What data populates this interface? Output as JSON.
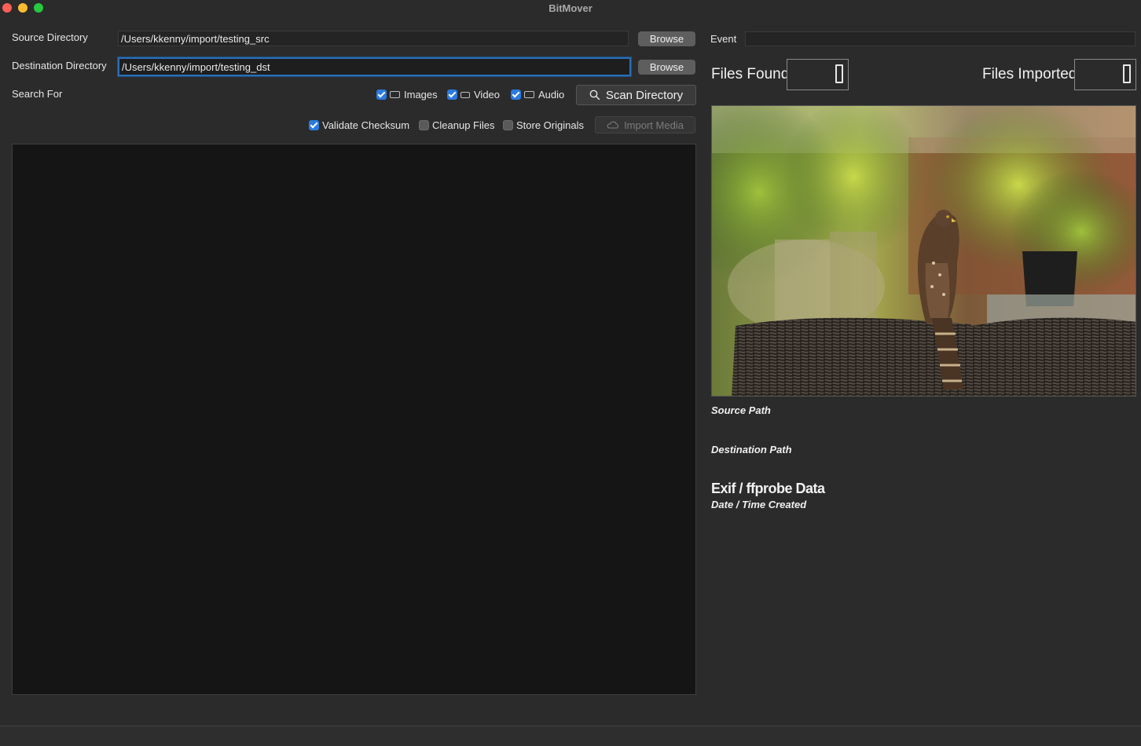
{
  "window": {
    "title": "BitMover"
  },
  "source": {
    "label": "Source Directory",
    "value": "/Users/kkenny/import/testing_src",
    "browse_label": "Browse"
  },
  "destination": {
    "label": "Destination Directory",
    "value": "/Users/kkenny/import/testing_dst",
    "browse_label": "Browse"
  },
  "search": {
    "label": "Search For",
    "options": [
      {
        "label": "Images",
        "checked": true,
        "icon": "camera-icon"
      },
      {
        "label": "Video",
        "checked": true,
        "icon": "video-camera-icon"
      },
      {
        "label": "Audio",
        "checked": true,
        "icon": "audio-icon"
      }
    ],
    "scan_button": "Scan Directory",
    "scan_icon": "magnifier-icon"
  },
  "import_options": [
    {
      "label": "Validate Checksum",
      "checked": true
    },
    {
      "label": "Cleanup Files",
      "checked": false
    },
    {
      "label": "Store Originals",
      "checked": false
    }
  ],
  "import_button": {
    "label": "Import Media",
    "enabled": false,
    "icon": "cloud-icon"
  },
  "event": {
    "label": "Event",
    "value": ""
  },
  "counters": {
    "files_found_label": "Files Found",
    "files_found_value": 0,
    "files_imported_label": "Files Imported",
    "files_imported_value": 0
  },
  "preview": {
    "subject": "hawk-perched-on-wicker-chair-photo"
  },
  "details": {
    "source_path_label": "Source Path",
    "destination_path_label": "Destination Path",
    "exif_heading": "Exif / ffprobe Data",
    "date_created_label": "Date / Time Created"
  },
  "colors": {
    "accent": "#2b7ae0",
    "focus_border": "#2a6eb5",
    "background": "#2b2b2b",
    "list_background": "#151515"
  }
}
